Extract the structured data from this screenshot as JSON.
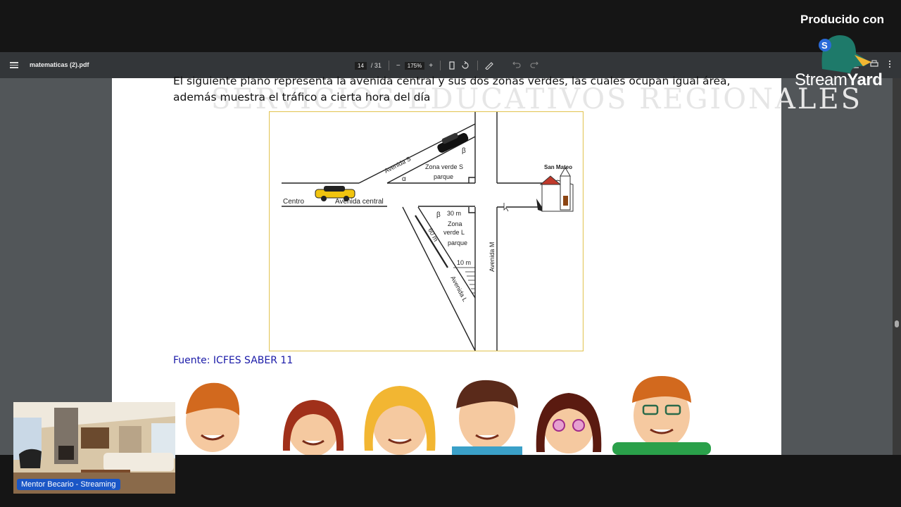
{
  "pdf_toolbar": {
    "filename": "matematicas (2).pdf",
    "page_current": "14",
    "page_total": "/ 31",
    "zoom": "175%",
    "minus": "−",
    "plus": "+"
  },
  "document": {
    "watermark": "SERVICIOS EDUCATIVOS REGIONALES",
    "paragraph": "El siguiente plano representa la avenida central y sus dos zonas verdes, las cuales ocupan igual área, además muestra el tráfico a cierta hora del día",
    "source": "Fuente: ICFES SABER 11",
    "figure": {
      "labels": {
        "centro": "Centro",
        "avenida_central": "Avenida central",
        "avenida_s": "Avenida S",
        "zona_verde_s": "Zona verde S",
        "parque_s": "parque",
        "alpha": "α",
        "beta_top": "β",
        "san_mateo": "San Mateo",
        "beta_bottom": "β",
        "dim_30": "30 m",
        "zona_verde_l_1": "Zona",
        "zona_verde_l_2": "verde L",
        "zona_verde_l_3": "parque",
        "dim_60": "60 m",
        "dim_10": "10 m",
        "avenida_l": "Avenida L",
        "avenida_m": "Avenida M"
      }
    }
  },
  "overlay": {
    "produced_by": "Producido con",
    "brand_stream": "Stream",
    "brand_yard": "Yard",
    "camera_label": "Mentor Becario - Streaming"
  },
  "colors": {
    "toolbar_bg": "#333639",
    "viewer_bg": "#525659",
    "figure_border": "#e3c65a",
    "source_text": "#1a1aa8",
    "camera_badge": "#1a56c6"
  }
}
